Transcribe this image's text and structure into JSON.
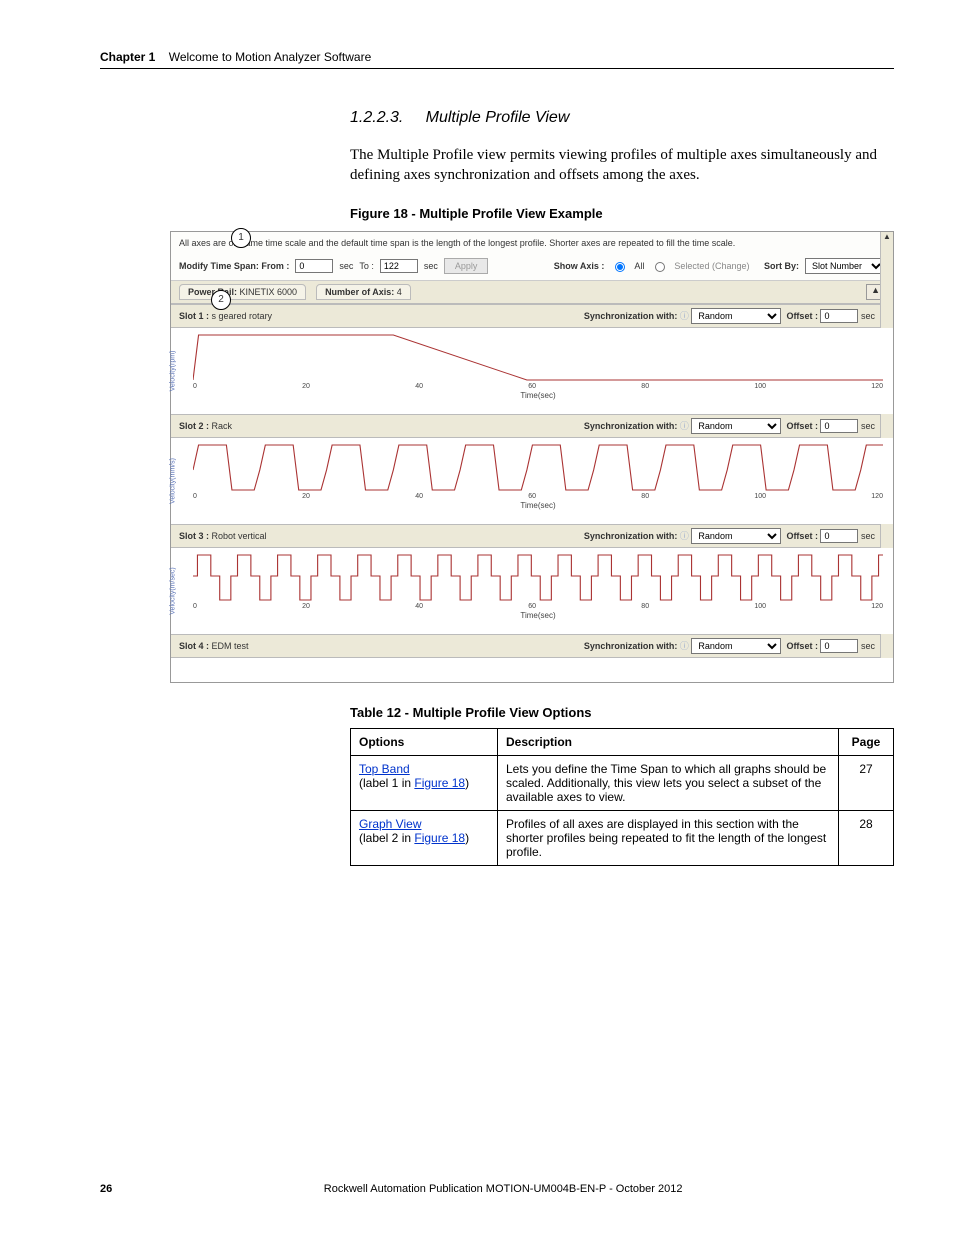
{
  "header": {
    "chapter_label": "Chapter 1",
    "chapter_title": "Welcome to Motion Analyzer Software"
  },
  "section": {
    "number": "1.2.2.3.",
    "title": "Multiple Profile View",
    "body": "The Multiple Profile view permits viewing profiles of multiple axes simultaneously and defining axes synchronization and offsets among the axes."
  },
  "figure": {
    "caption": "Figure 18 - Multiple Profile View Example",
    "info_text": "All axes are on same time scale and the default time span is the length of the longest profile. Shorter axes are repeated to fill the time scale.",
    "timebar": {
      "label": "Modify Time Span: From :",
      "from_value": "0",
      "sec1": "sec",
      "to_label": "To :",
      "to_value": "122",
      "sec2": "sec",
      "apply": "Apply",
      "show_axis": "Show Axis :",
      "opt_all": "All",
      "opt_selected": "Selected (Change)",
      "sort_by": "Sort By:",
      "sort_value": "Slot Number"
    },
    "rail": {
      "power_rail_label": "Power Rail:",
      "power_rail_value": "KINETIX 6000",
      "num_axis_label": "Number of Axis:",
      "num_axis_value": "4"
    },
    "slots": [
      {
        "name": "Slot 1 :",
        "title": "s geared rotary",
        "sync_label": "Synchronization with:",
        "sync_value": "Random",
        "offset_label": "Offset :",
        "offset_value": "0",
        "offset_unit": "sec",
        "ylabel": "Velocity(rpm)",
        "xlabel": "Time(sec)",
        "ticks": [
          "0",
          "20",
          "40",
          "60",
          "80",
          "100",
          "120"
        ]
      },
      {
        "name": "Slot 2 :",
        "title": "Rack",
        "sync_label": "Synchronization with:",
        "sync_value": "Random",
        "offset_label": "Offset :",
        "offset_value": "0",
        "offset_unit": "sec",
        "ylabel": "Velocity(mm/s)",
        "xlabel": "Time(sec)",
        "ticks": [
          "0",
          "20",
          "40",
          "60",
          "80",
          "100",
          "120"
        ]
      },
      {
        "name": "Slot 3 :",
        "title": "Robot vertical",
        "sync_label": "Synchronization with:",
        "sync_value": "Random",
        "offset_label": "Offset :",
        "offset_value": "0",
        "offset_unit": "sec",
        "ylabel": "Velocity(m/sec)",
        "xlabel": "Time(sec)",
        "ticks": [
          "0",
          "20",
          "40",
          "60",
          "80",
          "100",
          "120"
        ]
      },
      {
        "name": "Slot 4 :",
        "title": "EDM test",
        "sync_label": "Synchronization with:",
        "sync_value": "Random",
        "offset_label": "Offset :",
        "offset_value": "0",
        "offset_unit": "sec"
      }
    ],
    "callouts": {
      "c1": "1",
      "c2": "2"
    }
  },
  "table": {
    "caption": "Table 12 - Multiple Profile View Options",
    "headers": {
      "options": "Options",
      "description": "Description",
      "page": "Page"
    },
    "rows": [
      {
        "opt_link": "Top Band",
        "opt_label_prefix": "(label 1 in ",
        "opt_label_link": "Figure 18",
        "opt_label_suffix": ")",
        "desc": "Lets you define the Time Span to which all graphs should be scaled. Additionally, this view lets you select a subset of the available axes to view.",
        "page": "27"
      },
      {
        "opt_link": "Graph View",
        "opt_label_prefix": "(label 2 in ",
        "opt_label_link": "Figure 18",
        "opt_label_suffix": ")",
        "desc": "Profiles of all axes are displayed in this section with the shorter profiles being repeated to fit the length of the longest profile.",
        "page": "28"
      }
    ]
  },
  "footer": {
    "page_number": "26",
    "publication": "Rockwell Automation Publication MOTION-UM004B-EN-P - October 2012"
  }
}
